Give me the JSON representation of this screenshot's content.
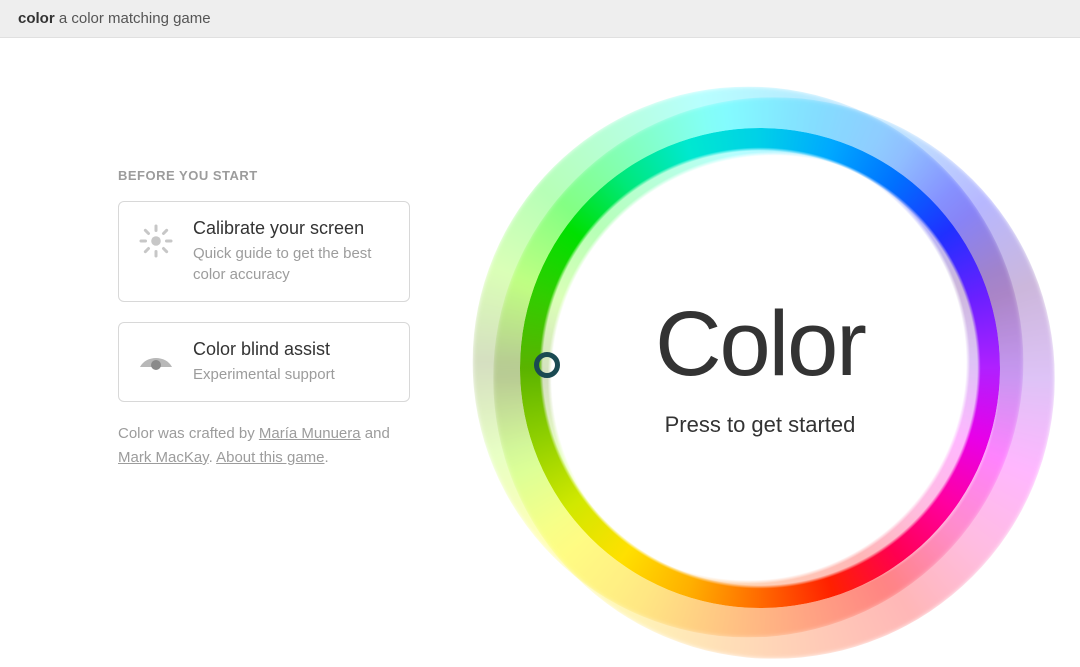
{
  "header": {
    "brand": "color",
    "tagline": "a color matching game"
  },
  "left": {
    "section_label": "BEFORE YOU START",
    "calibrate": {
      "title": "Calibrate your screen",
      "subtitle": "Quick guide to get the best color accuracy"
    },
    "colorblind": {
      "title": "Color blind assist",
      "subtitle": "Experimental support"
    },
    "credits": {
      "pre": "Color was crafted by ",
      "author1": "María Munuera",
      "mid": " and ",
      "author2": "Mark MacKay",
      "sep": ". ",
      "about": "About this game",
      "post": "."
    }
  },
  "wheel": {
    "title": "Color",
    "subtitle": "Press to get started"
  }
}
